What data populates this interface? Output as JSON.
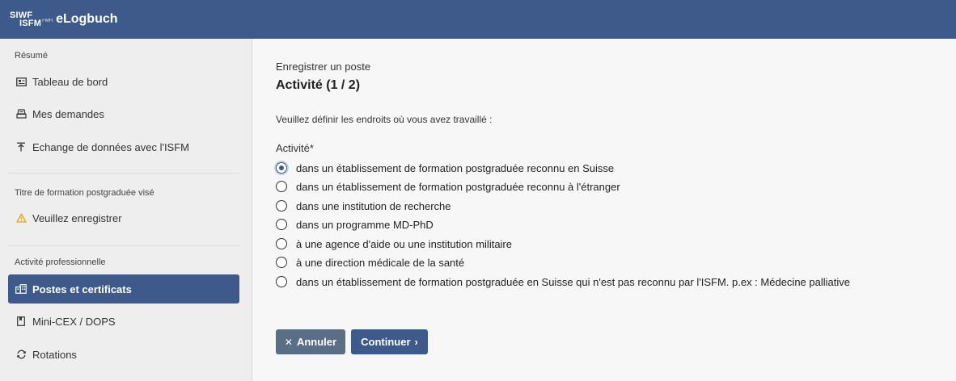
{
  "header": {
    "logo_line1": "SIWF",
    "logo_line2": "ISFM",
    "logo_fmh": "FMH",
    "app_title": "eLogbuch"
  },
  "sidebar": {
    "sections": [
      {
        "title": "Résumé",
        "items": [
          {
            "label": "Tableau de bord",
            "icon": "dashboard-icon"
          },
          {
            "label": "Mes demandes",
            "icon": "requests-icon"
          },
          {
            "label": "Echange de données avec l'ISFM",
            "icon": "upload-icon"
          }
        ]
      },
      {
        "title": "Titre de formation postgraduée visé",
        "items": [
          {
            "label": "Veuillez enregistrer",
            "icon": "warning-icon"
          }
        ]
      },
      {
        "title": "Activité professionnelle",
        "items": [
          {
            "label": "Postes et certificats",
            "icon": "buildings-icon",
            "active": true
          },
          {
            "label": "Mini-CEX / DOPS",
            "icon": "bookmark-icon"
          },
          {
            "label": "Rotations",
            "icon": "rotate-icon"
          }
        ]
      }
    ]
  },
  "main": {
    "subtitle": "Enregistrer un poste",
    "title": "Activité (1 / 2)",
    "intro": "Veuillez définir les endroits où vous avez travaillé :",
    "field_label": "Activité*",
    "options": [
      {
        "label": "dans un établissement de formation postgraduée reconnu en Suisse",
        "checked": true
      },
      {
        "label": "dans un établissement de formation postgraduée reconnu à l'étranger",
        "checked": false
      },
      {
        "label": "dans une institution de recherche",
        "checked": false
      },
      {
        "label": "dans un programme MD-PhD",
        "checked": false
      },
      {
        "label": "à une agence d'aide ou une institution militaire",
        "checked": false
      },
      {
        "label": "à une direction médicale de la santé",
        "checked": false
      },
      {
        "label": "dans un établissement de formation postgraduée en Suisse qui n'est pas reconnu par l'ISFM. p.ex : Médecine palliative",
        "checked": false
      }
    ],
    "cancel_label": "Annuler",
    "continue_label": "Continuer"
  },
  "colors": {
    "brand": "#3e5a8a",
    "cancel_button": "#5a6e86",
    "warning": "#e8a317"
  }
}
